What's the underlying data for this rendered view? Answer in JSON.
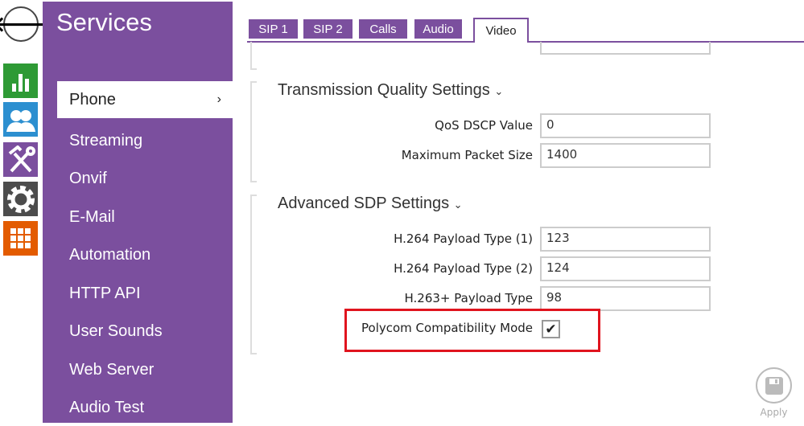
{
  "nav": {
    "back_icon": "arrow-left-icon",
    "icons": [
      {
        "name": "status-icon",
        "color": "#2e9a35"
      },
      {
        "name": "directory-icon",
        "color": "#2c8fd0"
      },
      {
        "name": "hardware-icon",
        "color": "#7b4f9e"
      },
      {
        "name": "system-icon",
        "color": "#4c4c4c"
      },
      {
        "name": "apps-icon",
        "color": "#e35b00"
      }
    ]
  },
  "sidebar": {
    "title": "Services",
    "items": [
      {
        "label": "Phone",
        "active": true
      },
      {
        "label": "Streaming"
      },
      {
        "label": "Onvif"
      },
      {
        "label": "E-Mail"
      },
      {
        "label": "Automation"
      },
      {
        "label": "HTTP API"
      },
      {
        "label": "User Sounds"
      },
      {
        "label": "Web Server"
      },
      {
        "label": "Audio Test"
      }
    ],
    "chevron": "›"
  },
  "tabs": [
    "SIP 1",
    "SIP 2",
    "Calls",
    "Audio",
    "Video"
  ],
  "active_tab": "Video",
  "sections": [
    {
      "title": "Transmission Quality Settings",
      "fields": [
        {
          "label": "QoS DSCP Value",
          "value": "0"
        },
        {
          "label": "Maximum Packet Size",
          "value": "1400"
        }
      ]
    },
    {
      "title": "Advanced SDP Settings",
      "fields": [
        {
          "label": "H.264 Payload Type (1)",
          "value": "123"
        },
        {
          "label": "H.264 Payload Type (2)",
          "value": "124"
        },
        {
          "label": "H.263+ Payload Type",
          "value": "98"
        }
      ],
      "checkbox": {
        "label": "Polycom Compatibility Mode",
        "checked": true,
        "mark": "✔"
      }
    }
  ],
  "highlight_color": "#e0141e",
  "apply": {
    "label": "Apply"
  }
}
